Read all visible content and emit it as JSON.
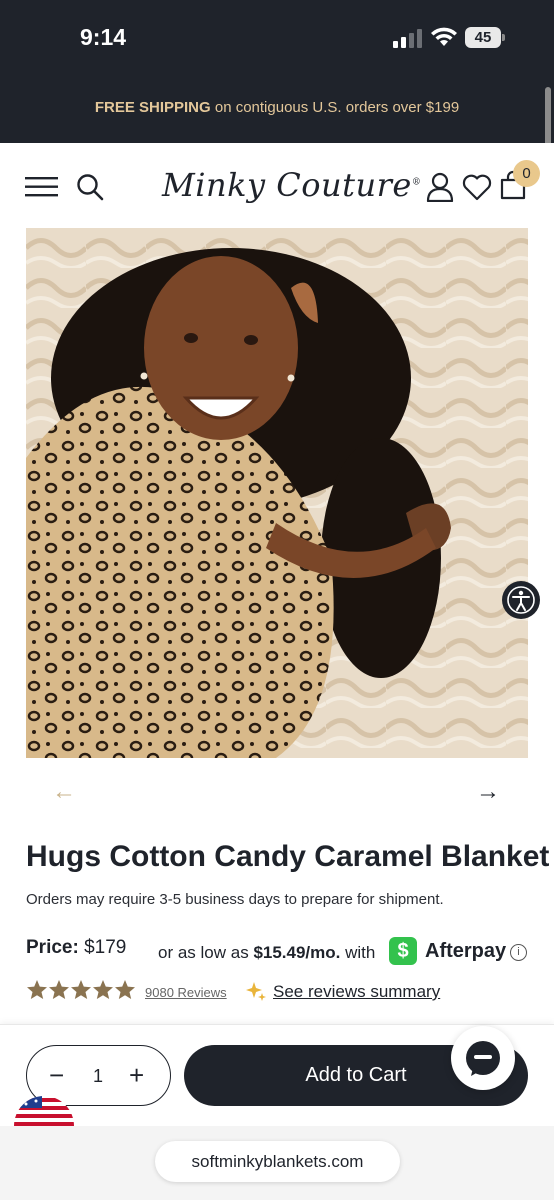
{
  "status_bar": {
    "time": "9:14",
    "battery": "45"
  },
  "promo": {
    "bold": "FREE SHIPPING",
    "rest": " on contiguous U.S. orders over $199"
  },
  "header": {
    "brand": "Minky Couture",
    "cart_count": "0",
    "icons": [
      "menu-icon",
      "search-icon",
      "account-icon",
      "heart-icon",
      "cart-icon"
    ]
  },
  "gallery": {
    "prev_arrow": "←",
    "next_arrow": "→"
  },
  "product": {
    "title": "Hugs Cotton Candy Caramel Blanket",
    "note": "Orders may require 3-5 business days to prepare for shipment.",
    "price_label": "Price:",
    "price_value": "$179",
    "installment_prefix": "or as low as ",
    "installment_amount": "$15.49/mo.",
    "installment_suffix": " with",
    "cash_symbol": "$",
    "afterpay_brand": "Afterpay",
    "info_symbol": "i",
    "rating": 5,
    "reviews_link": "9080 Reviews",
    "summary_link": "See reviews summary"
  },
  "cart_bar": {
    "minus": "−",
    "quantity": "1",
    "plus": "+",
    "add_to_cart": "Add to Cart"
  },
  "browser": {
    "url": "softminkyblankets.com"
  },
  "colors": {
    "dark": "#1f232b",
    "gold": "#e3c79a",
    "badge": "#e9c88c",
    "stars": "#8a7350",
    "cash_green": "#33c24d"
  }
}
